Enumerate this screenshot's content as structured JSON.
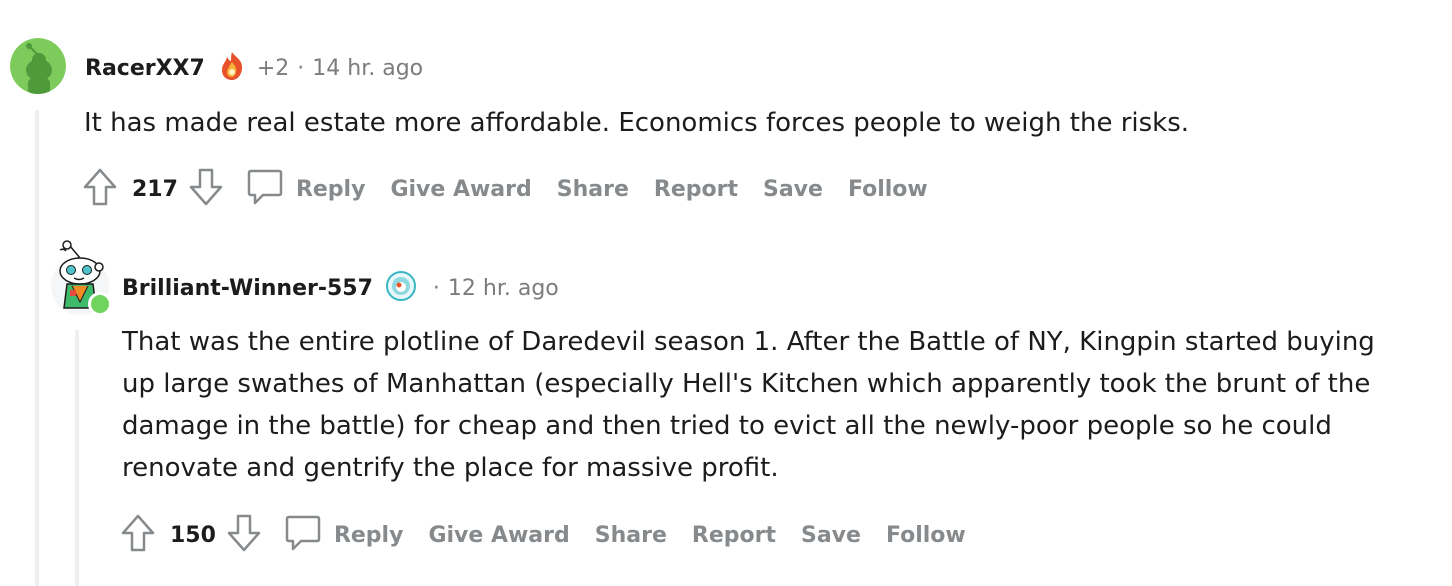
{
  "comments": [
    {
      "username": "RacerXX7",
      "flair_icon": "fire-badge-icon",
      "extra_flair": "+2",
      "separator": "·",
      "time": "14 hr. ago",
      "body": "It has made real estate more affordable. Economics forces people to weigh the risks.",
      "score": "217",
      "actions": {
        "reply": "Reply",
        "give_award": "Give Award",
        "share": "Share",
        "report": "Report",
        "save": "Save",
        "follow": "Follow"
      }
    },
    {
      "username": "Brilliant-Winner-557",
      "flair_icon": "snoo-badge-icon",
      "separator": "·",
      "time": "12 hr. ago",
      "body_lines": [
        "That was the entire plotline of Daredevil season 1. After the Battle of NY, Kingpin started buying",
        "up large swathes of Manhattan (especially Hell's Kitchen which apparently took the brunt of the",
        "damage in the battle) for cheap and then tried to evict all the newly-poor people so he could",
        "renovate and gentrify the place for massive profit."
      ],
      "score": "150",
      "online_status": "online",
      "actions": {
        "reply": "Reply",
        "give_award": "Give Award",
        "share": "Share",
        "report": "Report",
        "save": "Save",
        "follow": "Follow"
      }
    }
  ],
  "colors": {
    "thread_line": "#edeff1",
    "action_text": "#878a8c",
    "avatar_green": "#7dcb5b",
    "online_dot": "#6fd35c"
  }
}
